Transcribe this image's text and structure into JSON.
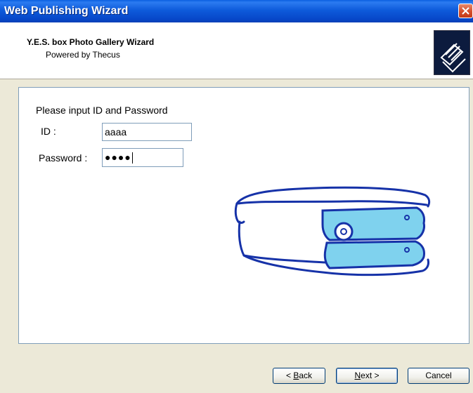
{
  "window": {
    "title": "Web Publishing Wizard"
  },
  "header": {
    "title": "Y.E.S. box Photo Gallery Wizard",
    "subtitle": "Powered by Thecus"
  },
  "form": {
    "prompt": "Please input ID and Password",
    "id_label": "ID :",
    "id_value": "aaaa",
    "password_label": "Password :",
    "password_value": "●●●●"
  },
  "buttons": {
    "back_prefix": "< ",
    "back_mnemonic": "B",
    "back_rest": "ack",
    "next_mnemonic": "N",
    "next_rest": "ext >",
    "cancel": "Cancel"
  }
}
